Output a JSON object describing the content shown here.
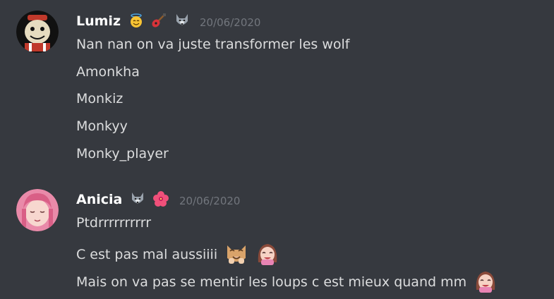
{
  "messages": [
    {
      "author": "Lumiz",
      "timestamp": "20/06/2020",
      "badges": [
        "smiling-halo-icon",
        "guitar-icon",
        "wolf-icon"
      ],
      "lines": [
        "Nan nan on va juste transformer les wolf",
        "Amonkha",
        "Monkiz",
        "Monkyy",
        "Monky_player"
      ]
    },
    {
      "author": "Anicia",
      "timestamp": "20/06/2020",
      "badges": [
        "wolf-icon",
        "hibiscus-icon"
      ],
      "lines": [
        "Ptdrrrrrrrrrr",
        "C est pas mal aussiiii",
        "Mais on va pas se mentir les loups c est mieux quand mm"
      ]
    }
  ],
  "colors": {
    "background": "#36393f",
    "author": "#ffffff",
    "timestamp": "#72767d",
    "text": "#dcddde"
  }
}
